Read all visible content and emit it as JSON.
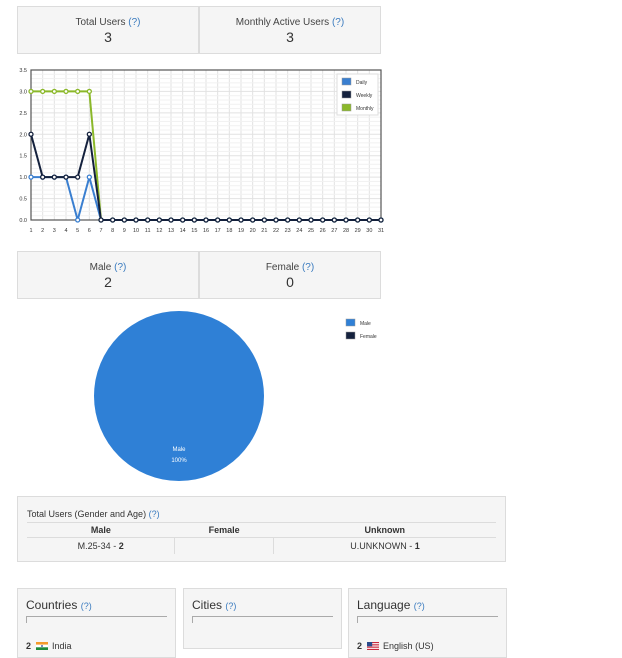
{
  "stats_top": [
    {
      "label": "Total Users",
      "help": "(?)",
      "value": "3"
    },
    {
      "label": "Monthly Active Users",
      "help": "(?)",
      "value": "3"
    }
  ],
  "stats_gender": [
    {
      "label": "Male",
      "help": "(?)",
      "value": "2"
    },
    {
      "label": "Female",
      "help": "(?)",
      "value": "0"
    }
  ],
  "chart_data": [
    {
      "type": "line",
      "x": [
        1,
        2,
        3,
        4,
        5,
        6,
        7,
        8,
        9,
        10,
        11,
        12,
        13,
        14,
        15,
        16,
        17,
        18,
        19,
        20,
        21,
        22,
        23,
        24,
        25,
        26,
        27,
        28,
        29,
        30,
        31
      ],
      "ylim": [
        0,
        3.5
      ],
      "yticks": [
        "0.0",
        "0.5",
        "1.0",
        "1.5",
        "2.0",
        "2.5",
        "3.0",
        "3.5"
      ],
      "grid": true,
      "legend_position": "top-right",
      "series": [
        {
          "name": "Daily",
          "color": "#3a7fd0",
          "values": [
            1,
            1,
            1,
            1,
            0,
            1,
            0,
            0,
            0,
            0,
            0,
            0,
            0,
            0,
            0,
            0,
            0,
            0,
            0,
            0,
            0,
            0,
            0,
            0,
            0,
            0,
            0,
            0,
            0,
            0,
            0
          ]
        },
        {
          "name": "Weekly",
          "color": "#14213d",
          "values": [
            2,
            1,
            1,
            1,
            1,
            2,
            0,
            0,
            0,
            0,
            0,
            0,
            0,
            0,
            0,
            0,
            0,
            0,
            0,
            0,
            0,
            0,
            0,
            0,
            0,
            0,
            0,
            0,
            0,
            0,
            0
          ]
        },
        {
          "name": "Monthly",
          "color": "#8bb82a",
          "values": [
            3,
            3,
            3,
            3,
            3,
            3,
            0,
            0,
            0,
            0,
            0,
            0,
            0,
            0,
            0,
            0,
            0,
            0,
            0,
            0,
            0,
            0,
            0,
            0,
            0,
            0,
            0,
            0,
            0,
            0,
            0
          ]
        }
      ]
    },
    {
      "type": "pie",
      "legend_position": "top-right",
      "slices": [
        {
          "name": "Male",
          "value": 100,
          "color": "#2f80d6",
          "label": "Male",
          "pct_label": "100%"
        },
        {
          "name": "Female",
          "value": 0,
          "color": "#14213d"
        }
      ]
    }
  ],
  "gender_age_table": {
    "title": "Total Users (Gender and Age)",
    "help": "(?)",
    "headers": [
      "Male",
      "Female",
      "Unknown"
    ],
    "rows": [
      [
        {
          "prefix": "M.25-34 - ",
          "count": "2"
        },
        {
          "prefix": "",
          "count": ""
        },
        {
          "prefix": "U.UNKNOWN - ",
          "count": "1"
        }
      ]
    ]
  },
  "bottom_panels": [
    {
      "title": "Countries",
      "help": "(?)",
      "item_count": "2",
      "item_label": "India",
      "flag": "india-flag-icon"
    },
    {
      "title": "Cities",
      "help": "(?)",
      "item_count": "",
      "item_label": "",
      "flag": ""
    },
    {
      "title": "Language",
      "help": "(?)",
      "item_count": "2",
      "item_label": "English (US)",
      "flag": "us-flag-icon"
    }
  ]
}
